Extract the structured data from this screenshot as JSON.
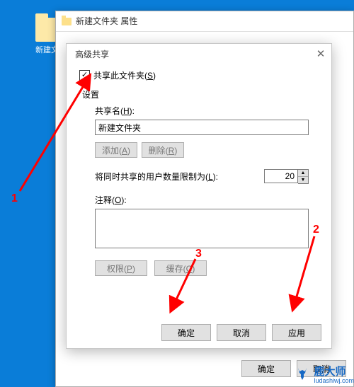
{
  "desktop": {
    "folder_label": "新建文件"
  },
  "outer": {
    "title": "新建文件夹 属性",
    "ok": "确定",
    "cancel": "取消"
  },
  "inner": {
    "title": "高级共享",
    "close_icon": "✕",
    "share_checkbox_label": "共享此文件夹(",
    "share_checkbox_key": "S",
    "share_checkbox_close": ")",
    "checked": true,
    "settings_label": "设置",
    "share_name_label": "共享名(",
    "share_name_key": "H",
    "share_name_close": "):",
    "share_name_value": "新建文件夹",
    "add_label": "添加(",
    "add_key": "A",
    "add_close": ")",
    "remove_label": "删除(",
    "remove_key": "R",
    "remove_close": ")",
    "limit_label_pre": "将同时共享的用户数量限制为(",
    "limit_key": "L",
    "limit_close": "):",
    "limit_value": "20",
    "comment_label_pre": "注释(",
    "comment_key": "O",
    "comment_close": "):",
    "comment_value": "",
    "perm_label": "权限(",
    "perm_key": "P",
    "perm_close": ")",
    "cache_label": "缓存(",
    "cache_key": "C",
    "cache_close": ")",
    "ok": "确定",
    "cancel": "取消",
    "apply": "应用"
  },
  "annotations": {
    "n1": "1",
    "n2": "2",
    "n3": "3"
  },
  "watermark": {
    "brand": "鹿大师",
    "url": "ludashiwj.com"
  },
  "colors": {
    "arrow": "#ff0000",
    "desktop_bg": "#0a7dd8",
    "brand": "#1769c4"
  }
}
